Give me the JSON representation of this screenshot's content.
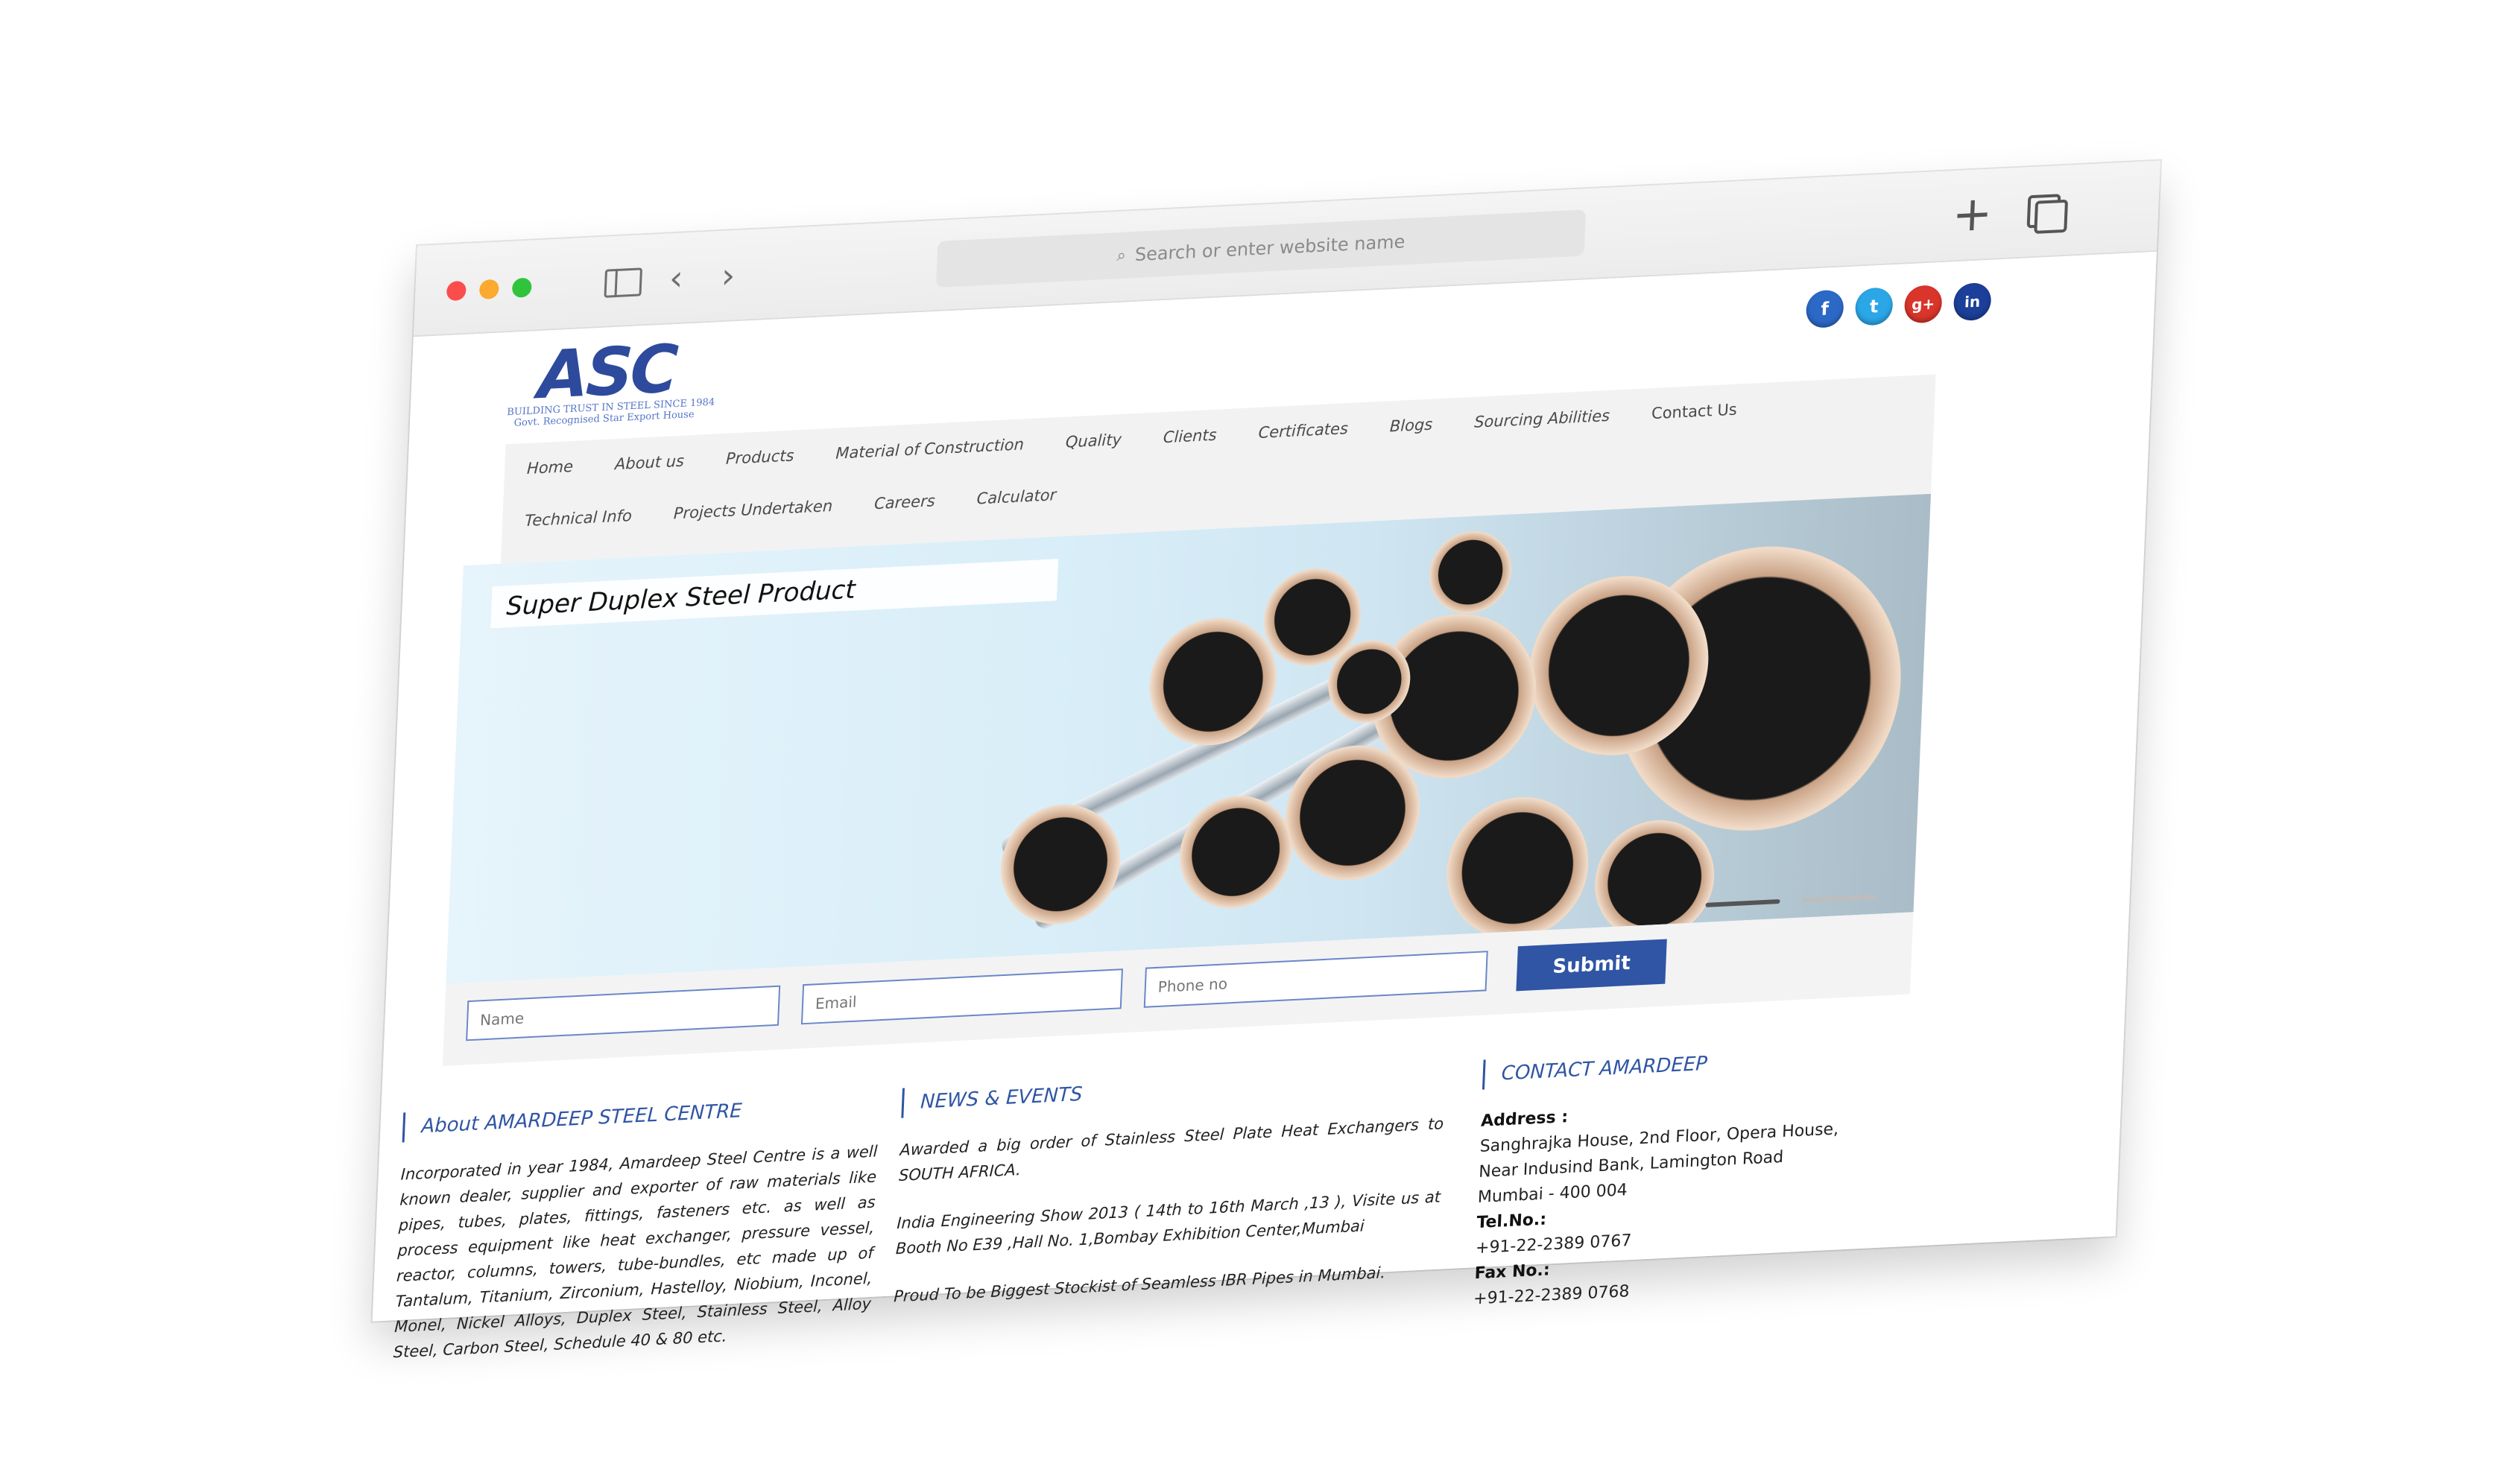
{
  "browser": {
    "search_placeholder": "Search or enter website name"
  },
  "site": {
    "logo_text": "ASC",
    "logo_tagline": "BUILDING TRUST IN STEEL SINCE 1984",
    "logo_subtagline": "Govt. Recognised Star Export House",
    "social": [
      {
        "name": "facebook",
        "glyph": "f"
      },
      {
        "name": "twitter",
        "glyph": "t"
      },
      {
        "name": "google-plus",
        "glyph": "g+"
      },
      {
        "name": "linkedin",
        "glyph": "in"
      }
    ],
    "nav_row1": [
      "Home",
      "About us",
      "Products",
      "Material of Construction",
      "Quality",
      "Clients",
      "Certificates",
      "Blogs",
      "Sourcing Abilities",
      "Contact Us"
    ],
    "nav_row2": [
      "Technical Info",
      "Projects Undertaken",
      "Careers",
      "Calculator"
    ]
  },
  "hero": {
    "caption": "Super Duplex Steel Product"
  },
  "form": {
    "name_placeholder": "Name",
    "email_placeholder": "Email",
    "phone_placeholder": "Phone no",
    "submit_label": "Submit"
  },
  "about": {
    "heading": "About AMARDEEP STEEL CENTRE",
    "text": "Incorporated in year 1984, Amardeep Steel Centre is a well known dealer, supplier and exporter of raw materials like pipes, tubes, plates, fittings, fasteners etc. as well as process equipment like heat exchanger, pressure vessel, reactor, columns, towers, tube-bundles, etc made up of Tantalum, Titanium, Zirconium, Hastelloy, Niobium, Inconel, Monel, Nickel Alloys, Duplex Steel, Stainless Steel, Alloy Steel, Carbon Steel, Schedule 40 & 80 etc."
  },
  "news": {
    "heading": "NEWS & EVENTS",
    "items": [
      "Awarded a big order of Stainless Steel Plate Heat Exchangers to SOUTH AFRICA.",
      "India Engineering Show 2013 ( 14th to 16th March ,13 ), Visite us at Booth No E39 ,Hall No. 1,Bombay Exhibition Center,Mumbai",
      "Proud To be Biggest Stockist of Seamless IBR Pipes in Mumbai."
    ]
  },
  "contact": {
    "heading": "CONTACT AMARDEEP",
    "address_label": "Address :",
    "address_line1": "Sanghrajka House, 2nd Floor, Opera House,",
    "address_line2": "Near Indusind Bank, Lamington Road",
    "address_line3": "Mumbai - 400 004",
    "tel_label": "Tel.No.:",
    "tel": "+91-22-2389 0767",
    "fax_label": "Fax No.:",
    "fax": "+91-22-2389 0768"
  }
}
